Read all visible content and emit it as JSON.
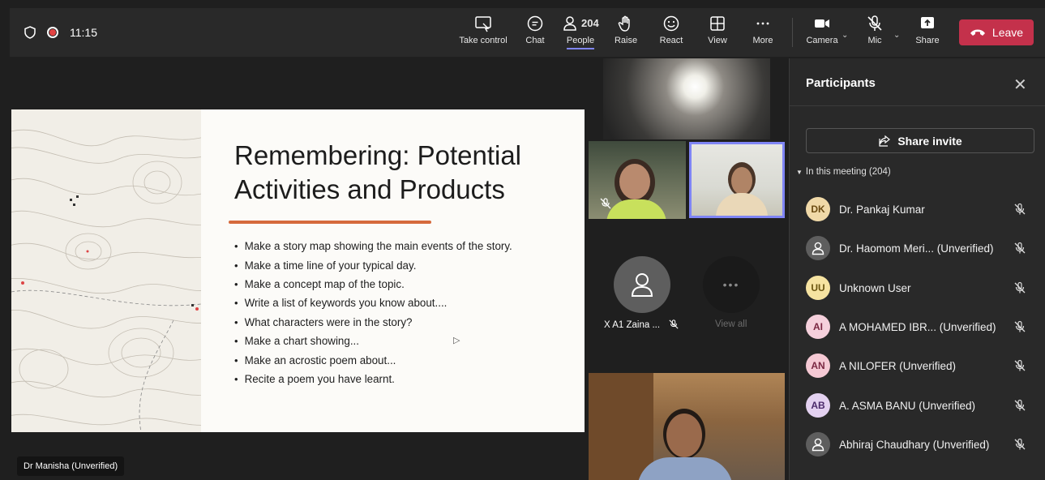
{
  "status": {
    "time": "11:15"
  },
  "toolbar": {
    "take_control": "Take control",
    "chat": "Chat",
    "people": "People",
    "people_count": "204",
    "raise": "Raise",
    "react": "React",
    "view": "View",
    "more": "More",
    "camera": "Camera",
    "mic": "Mic",
    "share": "Share",
    "leave": "Leave"
  },
  "slide": {
    "title_line1": "Remembering: Potential",
    "title_line2": "Activities and Products",
    "bullets": [
      "Make a story map showing the main events of the story.",
      "Make a time line of your typical day.",
      "Make a concept map of the topic.",
      "Write a list of keywords you know about....",
      "What characters were in the story?",
      "Make a chart showing...",
      "Make an acrostic poem about...",
      "Recite a poem you have learnt."
    ]
  },
  "presenter": {
    "name": "Dr Manisha (Unverified)"
  },
  "tiles": {
    "audio_name": "X A1 Zaina ...",
    "view_all": "View all"
  },
  "panel": {
    "title": "Participants",
    "share_invite": "Share invite",
    "section": "In this meeting (204)",
    "participants": [
      {
        "initials": "DK",
        "name": "Dr. Pankaj Kumar",
        "color": "#f0d9a8",
        "text_color": "#6b4b12"
      },
      {
        "initials": "",
        "name": "Dr. Haomom Meri... (Unverified)",
        "color": "#5e5e5e",
        "text_color": "#ffffff"
      },
      {
        "initials": "UU",
        "name": "Unknown User",
        "color": "#f6e3a1",
        "text_color": "#6b5510"
      },
      {
        "initials": "AI",
        "name": "A MOHAMED IBR... (Unverified)",
        "color": "#f5d0dc",
        "text_color": "#7a2742"
      },
      {
        "initials": "AN",
        "name": "A NILOFER (Unverified)",
        "color": "#f5c9d4",
        "text_color": "#7a2742"
      },
      {
        "initials": "AB",
        "name": "A. ASMA BANU (Unverified)",
        "color": "#e3d1f0",
        "text_color": "#4b2a6a"
      },
      {
        "initials": "",
        "name": "Abhiraj Chaudhary (Unverified)",
        "color": "#5e5e5e",
        "text_color": "#ffffff"
      }
    ]
  },
  "colors": {
    "accent": "#7f85f5",
    "leave": "#c4314b",
    "slide_underline": "#d56a3c"
  }
}
